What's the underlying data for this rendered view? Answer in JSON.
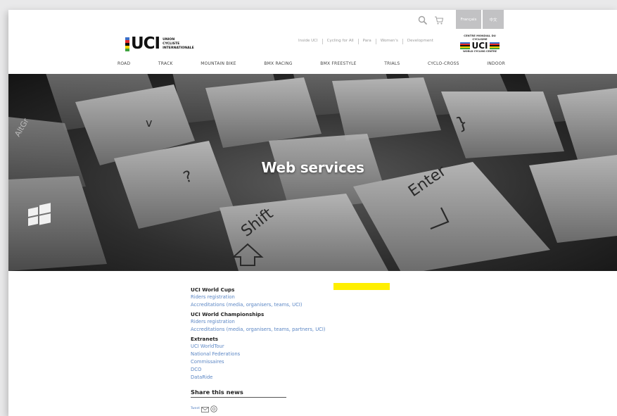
{
  "header": {
    "languages": [
      "Français",
      "中文"
    ],
    "logo": {
      "word": "UCI",
      "subtitle": [
        "UNION",
        "CYCLISTE",
        "INTERNATIONALE"
      ]
    },
    "secondary_nav": [
      "Inside UCI",
      "Cycling for All",
      "Para",
      "Women's",
      "Development"
    ],
    "wcc": {
      "top": "CENTRE MONDIAL DU CYCLISME",
      "word": "UCI",
      "bottom": "WORLD CYCLING CENTRE"
    },
    "main_nav": [
      "ROAD",
      "TRACK",
      "MOUNTAIN BIKE",
      "BMX RACING",
      "BMX FREESTYLE",
      "TRIALS",
      "CYCLO-CROSS",
      "INDOOR"
    ]
  },
  "hero": {
    "title": "Web services",
    "keys": [
      "Shift",
      "Enter"
    ]
  },
  "content": {
    "sections": [
      {
        "heading": "UCI World Cups",
        "links": [
          "Riders registration",
          "Accreditations (media, organisers, teams, UCI)"
        ]
      },
      {
        "heading": "UCI World Championships",
        "links": [
          "Riders registration",
          "Accreditations (media, organisers, teams, partners, UCI)"
        ]
      },
      {
        "heading": "Extranets",
        "links": [
          "UCI WorldTour",
          "National Federations",
          "Commissaires",
          "DCO",
          "DataRide"
        ]
      }
    ],
    "share_heading": "Share this news",
    "tweet_label": "Tweet"
  },
  "colors": {
    "link": "#5b86c4",
    "highlight": "#ffef00",
    "rainbow": [
      "#3b6fc9",
      "#e62727",
      "#111111",
      "#f5d200",
      "#3fa33f"
    ]
  }
}
